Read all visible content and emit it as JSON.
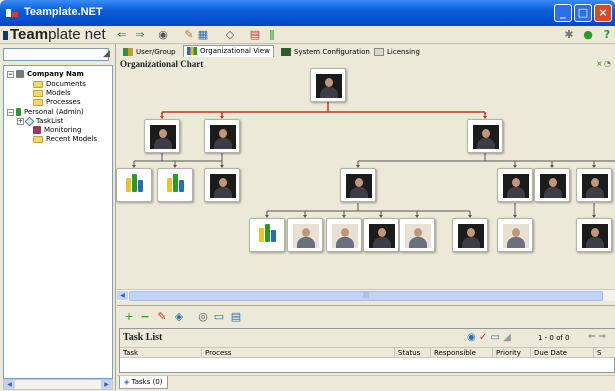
{
  "window": {
    "title": "Teamplate.NET"
  },
  "toolbar": {
    "brand_bold": "Team",
    "brand_rest": "plate net",
    "icons": [
      "back-arrow-icon",
      "forward-arrow-icon",
      "preview-icon",
      "palette-icon",
      "tag-icon",
      "edit-icon",
      "grid-icon"
    ]
  },
  "sidebar": {
    "search_value": "",
    "tree": [
      {
        "label": "Company Nam",
        "level": 0,
        "type": "company",
        "expand": "−"
      },
      {
        "label": "Documents",
        "level": 1,
        "type": "folder"
      },
      {
        "label": "Models",
        "level": 1,
        "type": "folder"
      },
      {
        "label": "Processes",
        "level": 1,
        "type": "folder"
      },
      {
        "label": "Personal (Admin)",
        "level": 0,
        "type": "person",
        "expand": "−"
      },
      {
        "label": "TaskList",
        "level": 1,
        "type": "tasklist",
        "expand": "+"
      },
      {
        "label": "Monitoring",
        "level": 1,
        "type": "monitor"
      },
      {
        "label": "Recent Models",
        "level": 1,
        "type": "folder"
      }
    ]
  },
  "tabs": [
    {
      "label": "User/Group",
      "active": false
    },
    {
      "label": "Organizational View",
      "active": true
    },
    {
      "label": "System Configuration",
      "active": false
    },
    {
      "label": "Licensing",
      "active": false
    }
  ],
  "org": {
    "title": "Organizational Chart",
    "scroll_marker": "|||"
  },
  "bottom": {
    "tasklist_title": "Task List",
    "count": "1 - 0 of 0",
    "columns": [
      "Task",
      "Process",
      "Status",
      "Responsible",
      "Priority",
      "Due Date",
      "S"
    ],
    "tab_label": "Tasks (0)"
  },
  "colors": {
    "titlebar": "#0a5fd8",
    "connector_red": "#c0392b",
    "accent_green": "#4aa02c"
  }
}
